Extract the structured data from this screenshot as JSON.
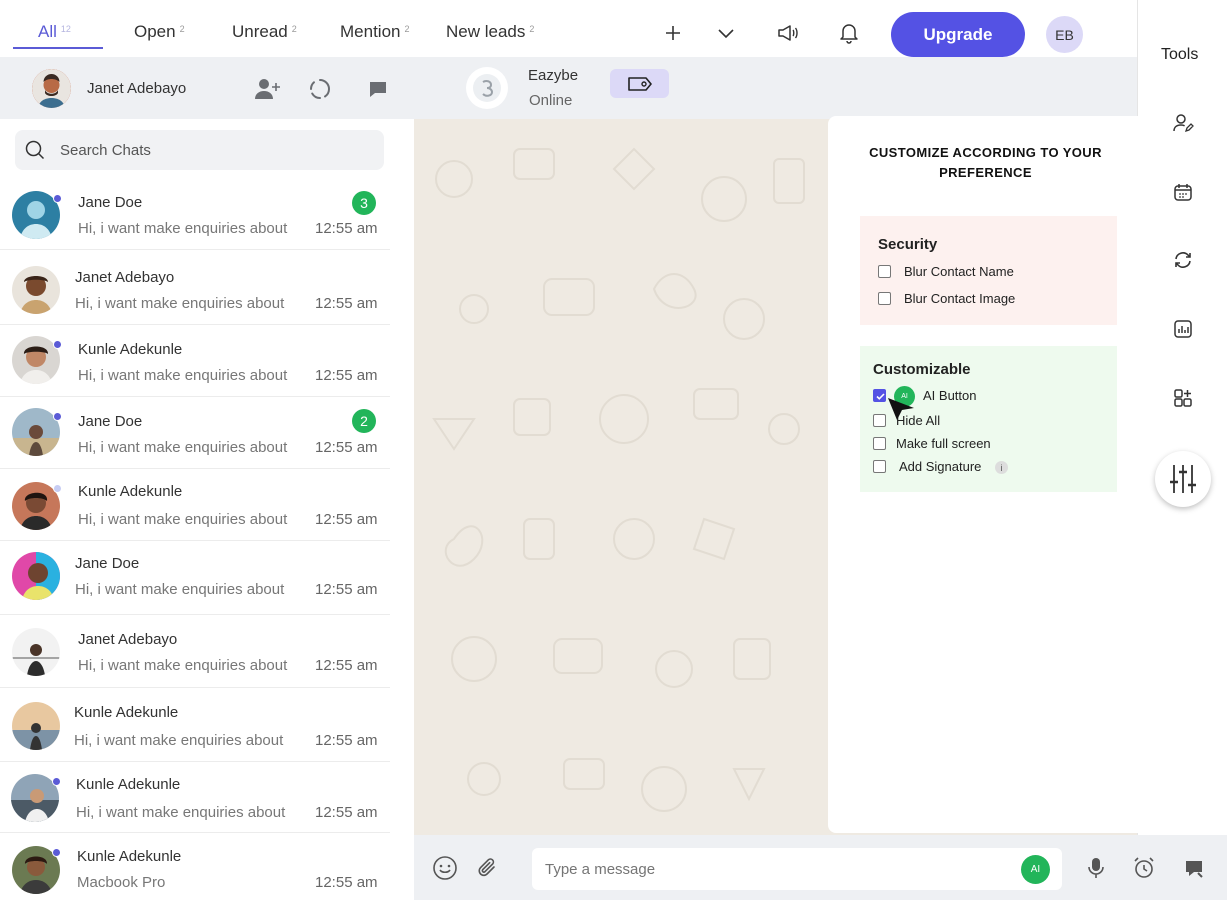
{
  "tabs": [
    {
      "label": "All",
      "count": "12"
    },
    {
      "label": "Open",
      "count": "2"
    },
    {
      "label": "Unread",
      "count": "2"
    },
    {
      "label": "Mention",
      "count": "2"
    },
    {
      "label": "New leads",
      "count": "2"
    }
  ],
  "top_actions": {
    "add_icon": "plus-icon",
    "dropdown_icon": "chevron-down-icon",
    "broadcast_icon": "megaphone-icon",
    "notification_icon": "bell-icon",
    "upgrade_label": "Upgrade",
    "user_initials": "EB"
  },
  "header": {
    "agent_name": "Janet Adebayo",
    "contact_name": "Eazybe",
    "contact_status": "Online"
  },
  "search": {
    "placeholder": "Search Chats"
  },
  "chats": [
    {
      "name": "Jane Doe",
      "preview": "Hi, i want make enquiries about",
      "time": "12:55 am",
      "unread": "3"
    },
    {
      "name": "Janet Adebayo",
      "preview": "Hi, i want make enquiries about",
      "time": "12:55 am",
      "unread": ""
    },
    {
      "name": "Kunle Adekunle",
      "preview": "Hi, i want make enquiries about",
      "time": "12:55 am",
      "unread": ""
    },
    {
      "name": "Jane Doe",
      "preview": "Hi, i want make enquiries about",
      "time": "12:55 am",
      "unread": "2"
    },
    {
      "name": "Kunle Adekunle",
      "preview": "Hi, i want make enquiries about",
      "time": "12:55 am",
      "unread": ""
    },
    {
      "name": "Jane Doe",
      "preview": "Hi, i want make enquiries about",
      "time": "12:55 am",
      "unread": ""
    },
    {
      "name": "Janet Adebayo",
      "preview": "Hi, i want make enquiries about",
      "time": "12:55 am",
      "unread": ""
    },
    {
      "name": "Kunle Adekunle",
      "preview": "Hi, i want make enquiries about",
      "time": "12:55 am",
      "unread": ""
    },
    {
      "name": "Kunle Adekunle",
      "preview": "Hi, i want make enquiries about",
      "time": "12:55 am",
      "unread": ""
    },
    {
      "name": "Kunle Adekunle",
      "preview": "Macbook Pro",
      "time": "12:55 am",
      "unread": ""
    }
  ],
  "composer": {
    "placeholder": "Type a message",
    "ai_label": "AI"
  },
  "tools": {
    "title": "Tools"
  },
  "panel": {
    "title": "CUSTOMIZE ACCORDING TO YOUR PREFERENCE",
    "security": {
      "heading": "Security",
      "options": [
        {
          "label": "Blur Contact Name",
          "checked": false
        },
        {
          "label": "Blur Contact Image",
          "checked": false
        }
      ]
    },
    "customizable": {
      "heading": "Customizable",
      "ai_chip": "AI",
      "options": [
        {
          "label": "AI Button",
          "checked": true
        },
        {
          "label": "Hide All",
          "checked": false
        },
        {
          "label": "Make full screen",
          "checked": false
        },
        {
          "label": "Add Signature",
          "checked": false
        }
      ],
      "info_icon": "i"
    }
  },
  "colors": {
    "accent": "#5452e4",
    "badge_green": "#22b55a",
    "security_bg": "#fdf1ef",
    "customizable_bg": "#eefaee"
  }
}
